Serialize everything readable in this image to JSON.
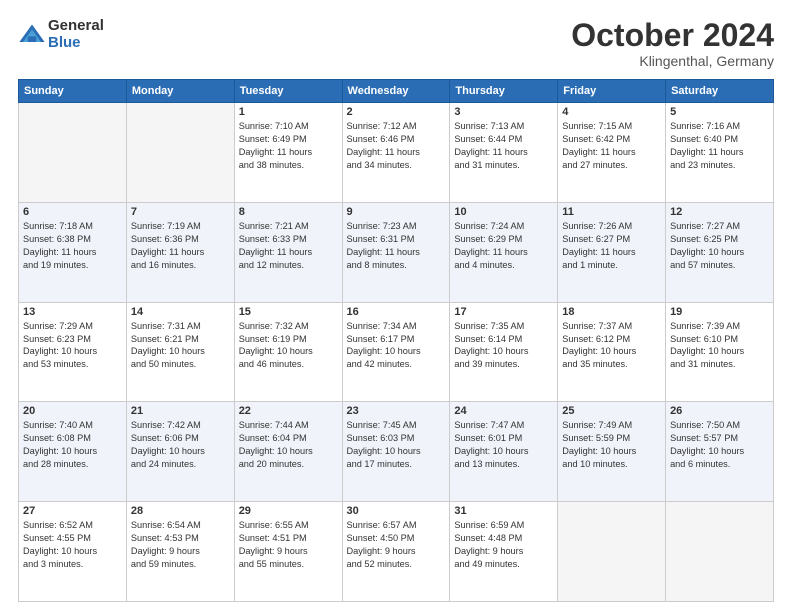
{
  "header": {
    "logo_general": "General",
    "logo_blue": "Blue",
    "month_title": "October 2024",
    "location": "Klingenthal, Germany"
  },
  "weekdays": [
    "Sunday",
    "Monday",
    "Tuesday",
    "Wednesday",
    "Thursday",
    "Friday",
    "Saturday"
  ],
  "weeks": [
    [
      {
        "day": "",
        "info": ""
      },
      {
        "day": "",
        "info": ""
      },
      {
        "day": "1",
        "info": "Sunrise: 7:10 AM\nSunset: 6:49 PM\nDaylight: 11 hours\nand 38 minutes."
      },
      {
        "day": "2",
        "info": "Sunrise: 7:12 AM\nSunset: 6:46 PM\nDaylight: 11 hours\nand 34 minutes."
      },
      {
        "day": "3",
        "info": "Sunrise: 7:13 AM\nSunset: 6:44 PM\nDaylight: 11 hours\nand 31 minutes."
      },
      {
        "day": "4",
        "info": "Sunrise: 7:15 AM\nSunset: 6:42 PM\nDaylight: 11 hours\nand 27 minutes."
      },
      {
        "day": "5",
        "info": "Sunrise: 7:16 AM\nSunset: 6:40 PM\nDaylight: 11 hours\nand 23 minutes."
      }
    ],
    [
      {
        "day": "6",
        "info": "Sunrise: 7:18 AM\nSunset: 6:38 PM\nDaylight: 11 hours\nand 19 minutes."
      },
      {
        "day": "7",
        "info": "Sunrise: 7:19 AM\nSunset: 6:36 PM\nDaylight: 11 hours\nand 16 minutes."
      },
      {
        "day": "8",
        "info": "Sunrise: 7:21 AM\nSunset: 6:33 PM\nDaylight: 11 hours\nand 12 minutes."
      },
      {
        "day": "9",
        "info": "Sunrise: 7:23 AM\nSunset: 6:31 PM\nDaylight: 11 hours\nand 8 minutes."
      },
      {
        "day": "10",
        "info": "Sunrise: 7:24 AM\nSunset: 6:29 PM\nDaylight: 11 hours\nand 4 minutes."
      },
      {
        "day": "11",
        "info": "Sunrise: 7:26 AM\nSunset: 6:27 PM\nDaylight: 11 hours\nand 1 minute."
      },
      {
        "day": "12",
        "info": "Sunrise: 7:27 AM\nSunset: 6:25 PM\nDaylight: 10 hours\nand 57 minutes."
      }
    ],
    [
      {
        "day": "13",
        "info": "Sunrise: 7:29 AM\nSunset: 6:23 PM\nDaylight: 10 hours\nand 53 minutes."
      },
      {
        "day": "14",
        "info": "Sunrise: 7:31 AM\nSunset: 6:21 PM\nDaylight: 10 hours\nand 50 minutes."
      },
      {
        "day": "15",
        "info": "Sunrise: 7:32 AM\nSunset: 6:19 PM\nDaylight: 10 hours\nand 46 minutes."
      },
      {
        "day": "16",
        "info": "Sunrise: 7:34 AM\nSunset: 6:17 PM\nDaylight: 10 hours\nand 42 minutes."
      },
      {
        "day": "17",
        "info": "Sunrise: 7:35 AM\nSunset: 6:14 PM\nDaylight: 10 hours\nand 39 minutes."
      },
      {
        "day": "18",
        "info": "Sunrise: 7:37 AM\nSunset: 6:12 PM\nDaylight: 10 hours\nand 35 minutes."
      },
      {
        "day": "19",
        "info": "Sunrise: 7:39 AM\nSunset: 6:10 PM\nDaylight: 10 hours\nand 31 minutes."
      }
    ],
    [
      {
        "day": "20",
        "info": "Sunrise: 7:40 AM\nSunset: 6:08 PM\nDaylight: 10 hours\nand 28 minutes."
      },
      {
        "day": "21",
        "info": "Sunrise: 7:42 AM\nSunset: 6:06 PM\nDaylight: 10 hours\nand 24 minutes."
      },
      {
        "day": "22",
        "info": "Sunrise: 7:44 AM\nSunset: 6:04 PM\nDaylight: 10 hours\nand 20 minutes."
      },
      {
        "day": "23",
        "info": "Sunrise: 7:45 AM\nSunset: 6:03 PM\nDaylight: 10 hours\nand 17 minutes."
      },
      {
        "day": "24",
        "info": "Sunrise: 7:47 AM\nSunset: 6:01 PM\nDaylight: 10 hours\nand 13 minutes."
      },
      {
        "day": "25",
        "info": "Sunrise: 7:49 AM\nSunset: 5:59 PM\nDaylight: 10 hours\nand 10 minutes."
      },
      {
        "day": "26",
        "info": "Sunrise: 7:50 AM\nSunset: 5:57 PM\nDaylight: 10 hours\nand 6 minutes."
      }
    ],
    [
      {
        "day": "27",
        "info": "Sunrise: 6:52 AM\nSunset: 4:55 PM\nDaylight: 10 hours\nand 3 minutes."
      },
      {
        "day": "28",
        "info": "Sunrise: 6:54 AM\nSunset: 4:53 PM\nDaylight: 9 hours\nand 59 minutes."
      },
      {
        "day": "29",
        "info": "Sunrise: 6:55 AM\nSunset: 4:51 PM\nDaylight: 9 hours\nand 55 minutes."
      },
      {
        "day": "30",
        "info": "Sunrise: 6:57 AM\nSunset: 4:50 PM\nDaylight: 9 hours\nand 52 minutes."
      },
      {
        "day": "31",
        "info": "Sunrise: 6:59 AM\nSunset: 4:48 PM\nDaylight: 9 hours\nand 49 minutes."
      },
      {
        "day": "",
        "info": ""
      },
      {
        "day": "",
        "info": ""
      }
    ]
  ]
}
